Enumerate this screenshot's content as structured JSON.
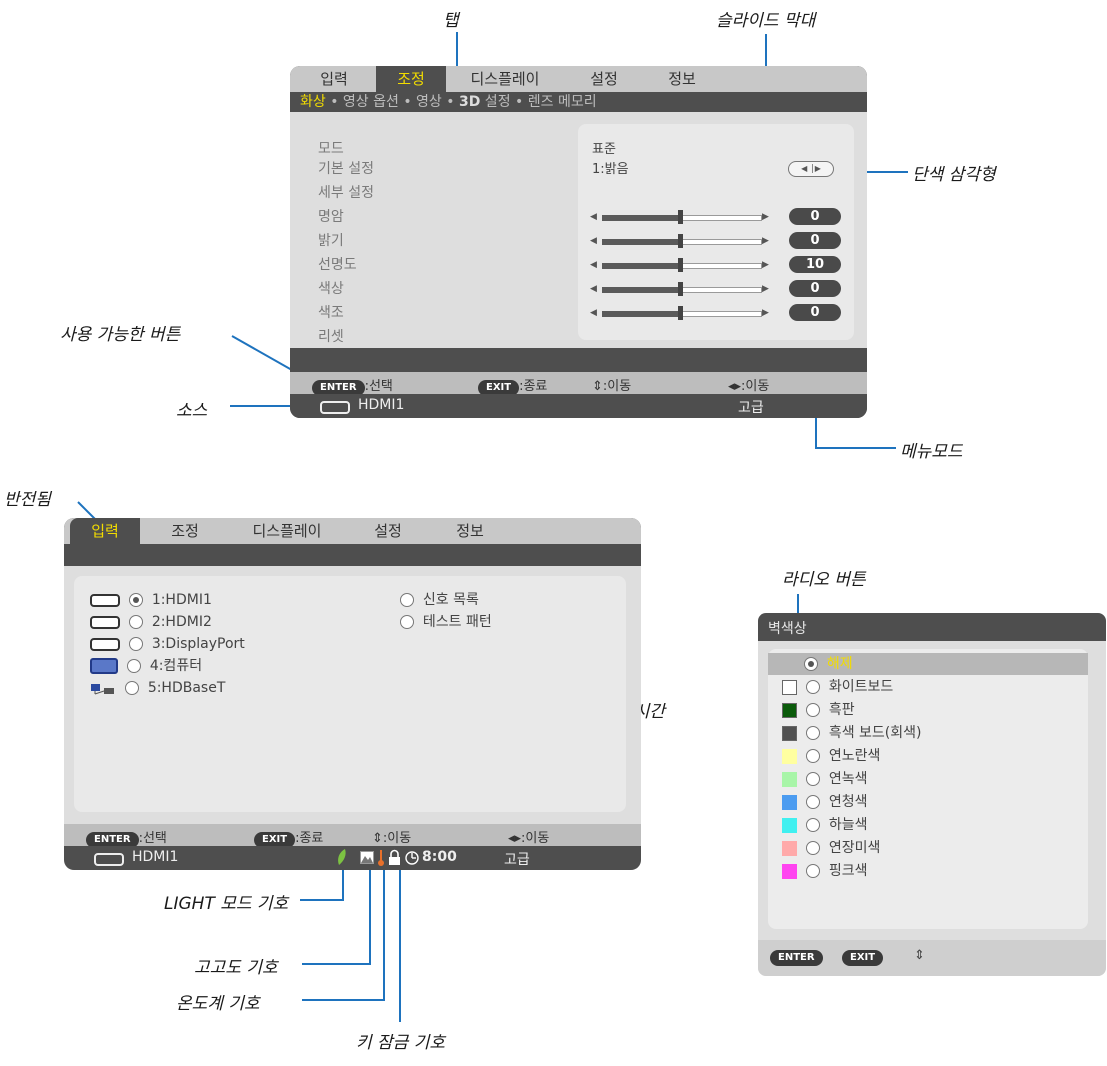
{
  "callouts": {
    "tab": "탭",
    "slider_bar": "슬라이드 막대",
    "solid_triangle": "단색 삼각형",
    "available_buttons": "사용 가능한 버튼",
    "source": "소스",
    "menu_mode": "메뉴모드",
    "highlight": "반전됨",
    "radio_button": "라디오 버튼",
    "light_mode_icon": "LIGHT 모드 기호",
    "altitude_icon": "고고도 기호",
    "thermometer_icon": "온도계 기호",
    "key_lock_icon": "키 잠금 기호",
    "off_timer": "타이머 꺼짐 남은 시간"
  },
  "menu1": {
    "tabs": [
      "입력",
      "조정",
      "디스플레이",
      "설정",
      "정보"
    ],
    "active_tab": 1,
    "subtabs": {
      "active": "화상",
      "rest": " • 영상 옵션 • 영상 • ",
      "bold": "3D",
      "tail": " 설정 • 렌즈 메모리"
    },
    "items": [
      "모드",
      "기본 설정",
      "세부 설정",
      "명암",
      "밝기",
      "선명도",
      "색상",
      "색조",
      "리셋"
    ],
    "mode_value": "표준",
    "preset_value": "1:밝음",
    "slider_values": [
      "0",
      "0",
      "10",
      "0",
      "0"
    ],
    "footer": {
      "enter": "ENTER",
      "enter_label": ":선택",
      "exit": "EXIT",
      "exit_label": ":종료",
      "updown": "⇕:이동",
      "leftright": "◂▸:이동"
    },
    "source": "HDMI1",
    "menu_mode": "고급"
  },
  "menu2": {
    "tabs": [
      "입력",
      "조정",
      "디스플레이",
      "설정",
      "정보"
    ],
    "active_tab": 0,
    "inputs": [
      "1:HDMI1",
      "2:HDMI2",
      "3:DisplayPort",
      "4:컴퓨터",
      "5:HDBaseT"
    ],
    "right_items": [
      "신호 목록",
      "테스트 패턴"
    ],
    "footer": {
      "enter": "ENTER",
      "enter_label": ":선택",
      "exit": "EXIT",
      "exit_label": ":종료",
      "updown": "⇕:이동",
      "leftright": "◂▸:이동"
    },
    "source": "HDMI1",
    "timer": "8:00",
    "menu_mode": "고급"
  },
  "menu3": {
    "title": "벽색상",
    "options": [
      {
        "label": "해제",
        "color": ""
      },
      {
        "label": "화이트보드",
        "color": "#ffffff"
      },
      {
        "label": "흑판",
        "color": "#0a5a0a"
      },
      {
        "label": "흑색 보드(회색)",
        "color": "#505050"
      },
      {
        "label": "연노란색",
        "color": "#ffffa0"
      },
      {
        "label": "연녹색",
        "color": "#a8f5a8"
      },
      {
        "label": "연청색",
        "color": "#4c9cf0"
      },
      {
        "label": "하늘색",
        "color": "#40f0f0"
      },
      {
        "label": "연장미색",
        "color": "#ffaaaa"
      },
      {
        "label": "핑크색",
        "color": "#ff44f0"
      }
    ],
    "selected": 0,
    "footer": {
      "enter": "ENTER",
      "exit": "EXIT",
      "updown": "⇕"
    }
  },
  "colors": {
    "accent": "#f2dc00",
    "dark": "#4e4e4e",
    "callout_line": "#1e73be"
  }
}
